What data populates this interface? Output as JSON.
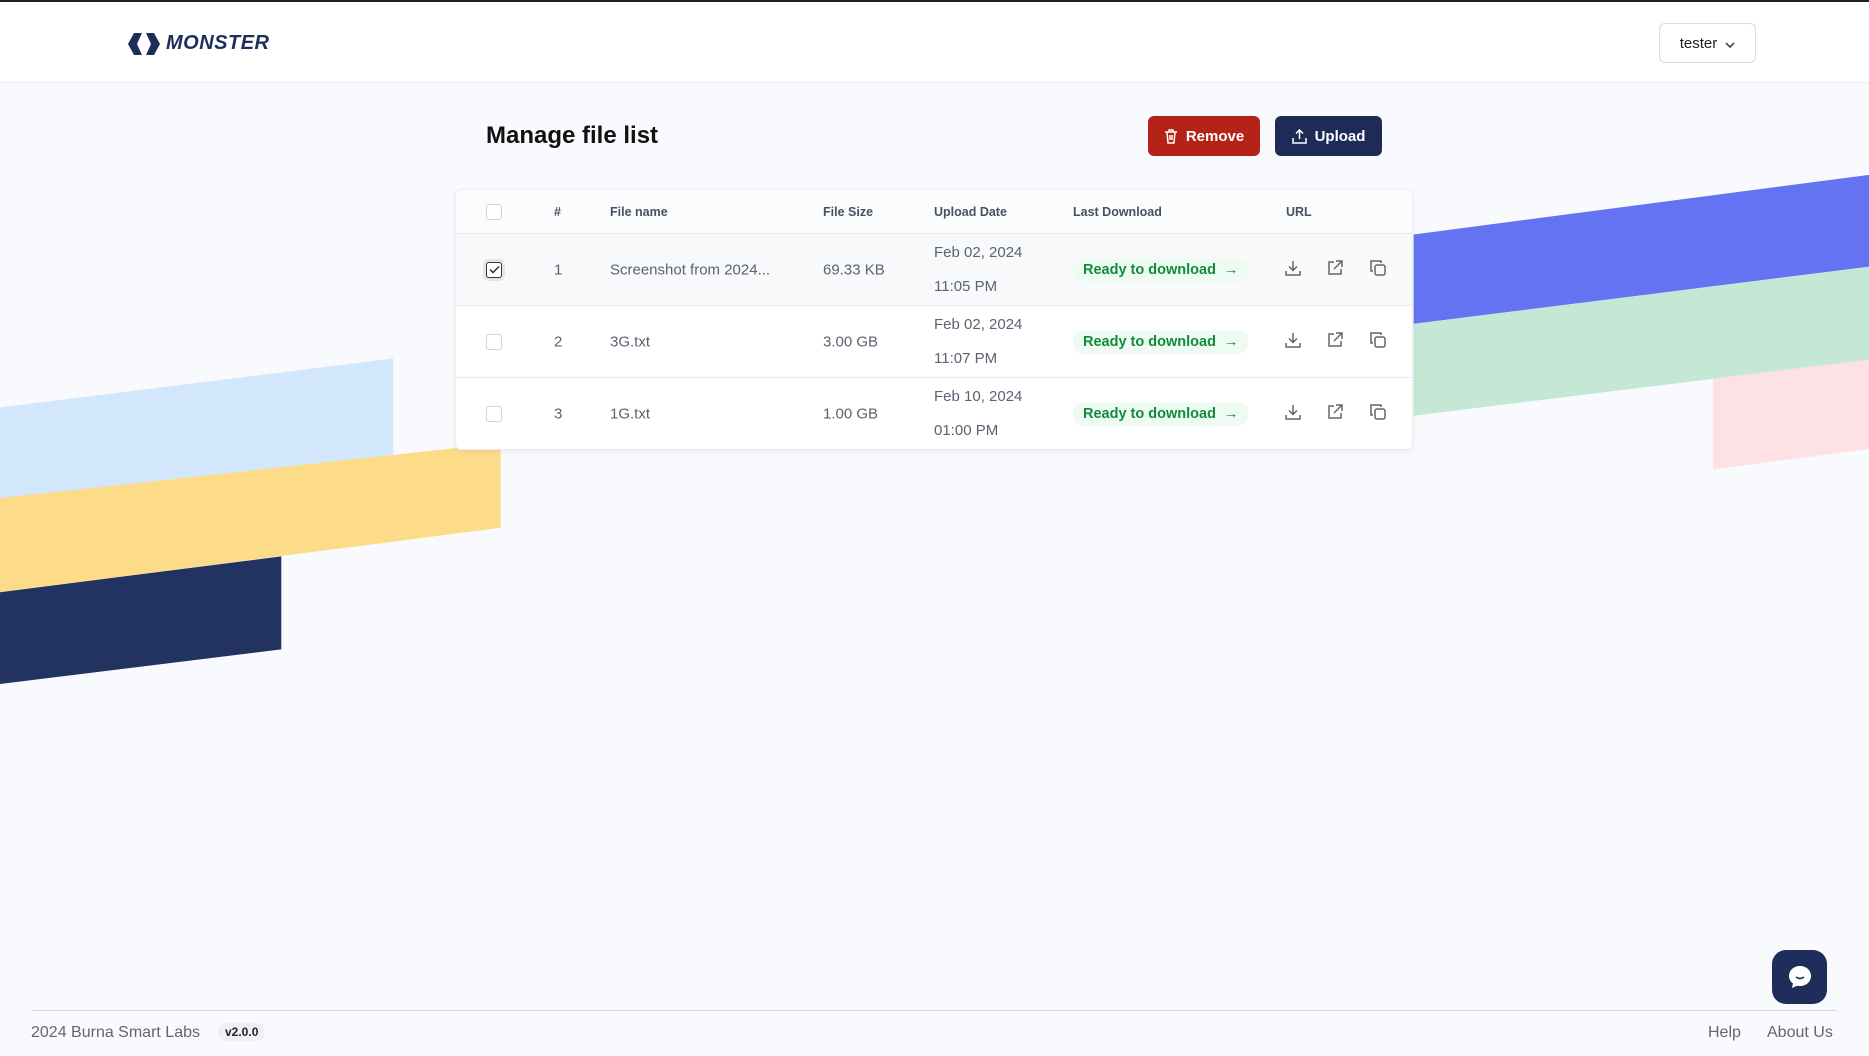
{
  "brand": {
    "name": "MONSTER"
  },
  "user": {
    "name": "tester"
  },
  "page": {
    "title": "Manage file list"
  },
  "actions": {
    "remove": "Remove",
    "upload": "Upload"
  },
  "table": {
    "headers": [
      "#",
      "File name",
      "File Size",
      "Upload Date",
      "Last Download",
      "URL"
    ],
    "rows": [
      {
        "num": "1",
        "name": "Screenshot from 2024...",
        "size": "69.33 KB",
        "date": "Feb 02, 2024",
        "time": "11:05 PM",
        "status": "Ready to download",
        "checked": true
      },
      {
        "num": "2",
        "name": "3G.txt",
        "size": "3.00 GB",
        "date": "Feb 02, 2024",
        "time": "11:07 PM",
        "status": "Ready to download",
        "checked": false
      },
      {
        "num": "3",
        "name": "1G.txt",
        "size": "1.00 GB",
        "date": "Feb 10, 2024",
        "time": "01:00 PM",
        "status": "Ready to download",
        "checked": false
      }
    ]
  },
  "footer": {
    "copyright": "2024 Burna Smart Labs",
    "version": "v2.0.0",
    "help": "Help",
    "about": "About Us"
  }
}
